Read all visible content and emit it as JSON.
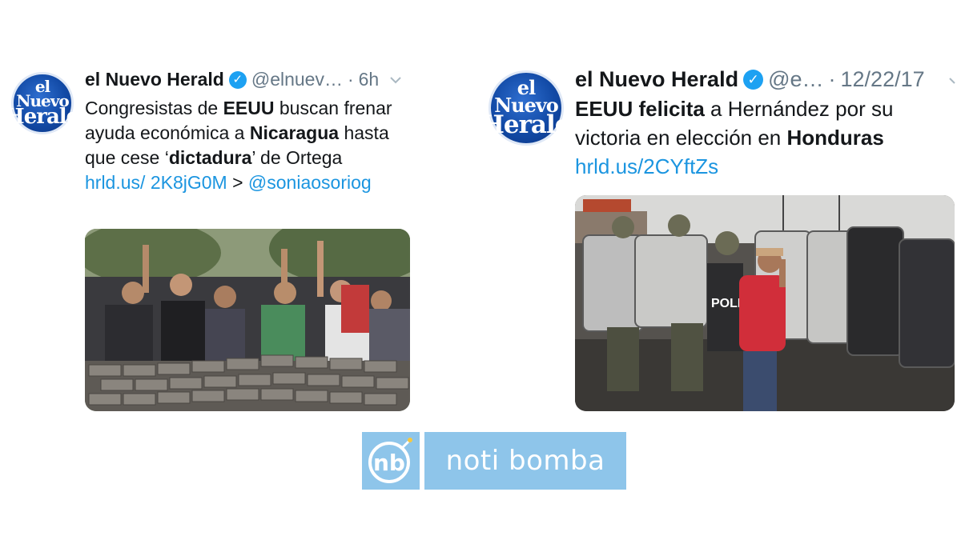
{
  "tweets": [
    {
      "author": "el Nuevo Herald",
      "avatar_line1": "el Nuevo",
      "avatar_line2": "Herald",
      "handle": "@elnuev…",
      "separator": "·",
      "time": "6h",
      "text": {
        "p1": "Congresistas de ",
        "b1": "EEUU",
        "p2": " buscan frenar ayuda económica a ",
        "b2": "Nicaragua",
        "p3": " hasta que cese ‘",
        "b3": "dictadura",
        "p4": "’ de Ortega ",
        "link1": "hrld.us/ 2K8jG0M",
        "p5": " > ",
        "link2": "@soniaosoriog"
      },
      "image_alt": "Protesters behind a barricade of paving stones"
    },
    {
      "author": "el Nuevo Herald",
      "avatar_line1": "el Nuevo",
      "avatar_line2": "Herald",
      "handle": "@e…",
      "separator": "·",
      "time": "12/22/17",
      "text": {
        "b1": "EEUU felicita",
        "p1": " a Hernández por su victoria en elección en ",
        "b2": "Honduras",
        "link1": "hrld.us/2CYftZs"
      },
      "image_alt": "Woman in red jacket in front of riot police shields"
    }
  ],
  "logo": {
    "icon_text": "nb",
    "wordmark": "noti bomba"
  },
  "colors": {
    "link": "#1b95e0",
    "verified": "#1da1f2",
    "logo_bg": "#8ec5ea",
    "avatar_blue": "#124aa6"
  }
}
